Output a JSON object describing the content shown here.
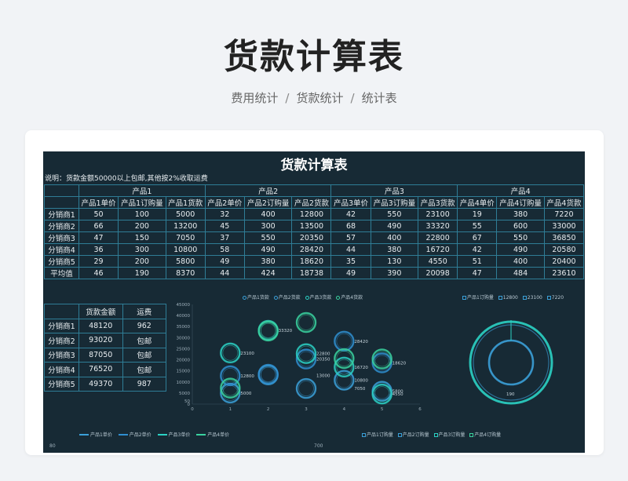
{
  "header": {
    "title": "货款计算表",
    "breadcrumb": [
      "费用统计",
      "货款统计",
      "统计表"
    ],
    "separator": "/"
  },
  "sheet": {
    "title": "货款计算表",
    "note": "说明：货款金额50000以上包邮,其他按2%收取运费",
    "groups": [
      "产品1",
      "产品2",
      "产品3",
      "产品4"
    ],
    "columns": [
      "产品1单价",
      "产品1订购量",
      "产品1货款",
      "产品2单价",
      "产品2订购量",
      "产品2货款",
      "产品3单价",
      "产品3订购量",
      "产品3货款",
      "产品4单价",
      "产品4订购量",
      "产品4货款"
    ],
    "rows": [
      {
        "label": "分销商1",
        "values": [
          "50",
          "100",
          "5000",
          "32",
          "400",
          "12800",
          "42",
          "550",
          "23100",
          "19",
          "380",
          "7220"
        ]
      },
      {
        "label": "分销商2",
        "values": [
          "66",
          "200",
          "13200",
          "45",
          "300",
          "13500",
          "68",
          "490",
          "33320",
          "55",
          "600",
          "33000"
        ]
      },
      {
        "label": "分销商3",
        "values": [
          "47",
          "150",
          "7050",
          "37",
          "550",
          "20350",
          "57",
          "400",
          "22800",
          "67",
          "550",
          "36850"
        ]
      },
      {
        "label": "分销商4",
        "values": [
          "36",
          "300",
          "10800",
          "58",
          "490",
          "28420",
          "44",
          "380",
          "16720",
          "42",
          "490",
          "20580"
        ]
      },
      {
        "label": "分销商5",
        "values": [
          "29",
          "200",
          "5800",
          "49",
          "380",
          "18620",
          "35",
          "130",
          "4550",
          "51",
          "400",
          "20400"
        ]
      },
      {
        "label": "平均值",
        "values": [
          "46",
          "190",
          "8370",
          "44",
          "424",
          "18738",
          "49",
          "390",
          "20098",
          "47",
          "484",
          "23610"
        ]
      }
    ],
    "fee_table": {
      "headers": [
        "",
        "货款金额",
        "运费"
      ],
      "rows": [
        [
          "分销商1",
          "48120",
          "962"
        ],
        [
          "分销商2",
          "93020",
          "包邮"
        ],
        [
          "分销商3",
          "87050",
          "包邮"
        ],
        [
          "分销商4",
          "76520",
          "包邮"
        ],
        [
          "分销商5",
          "49370",
          "987"
        ]
      ]
    }
  },
  "chart_data": [
    {
      "type": "scatter",
      "series": [
        {
          "name": "产品1货款",
          "x": [
            1,
            2,
            3,
            4,
            5
          ],
          "values": [
            5000,
            13200,
            7050,
            10800,
            5800
          ]
        },
        {
          "name": "产品2货款",
          "x": [
            1,
            2,
            3,
            4,
            5
          ],
          "values": [
            12800,
            13500,
            20350,
            28420,
            18620
          ]
        },
        {
          "name": "产品3货款",
          "x": [
            1,
            2,
            3,
            4,
            5
          ],
          "values": [
            23100,
            33320,
            22800,
            16720,
            4550
          ]
        },
        {
          "name": "产品4货款",
          "x": [
            1,
            2,
            3,
            4,
            5
          ],
          "values": [
            7220,
            33000,
            36850,
            20580,
            20400
          ]
        }
      ],
      "yticks": [
        "0",
        "50",
        "5000",
        "10000",
        "15000",
        "20000",
        "25000",
        "30000",
        "35000",
        "40000",
        "45000"
      ],
      "xticks": [
        "0",
        "1",
        "2",
        "3",
        "4",
        "5",
        "6"
      ],
      "point_labels": [
        {
          "x": 1,
          "y": 23100,
          "text": "23100"
        },
        {
          "x": 1,
          "y": 12800,
          "text": "12800"
        },
        {
          "x": 1,
          "y": 5000,
          "text": "5000"
        },
        {
          "x": 2,
          "y": 33320,
          "text": "33320"
        },
        {
          "x": 3,
          "y": 13000,
          "text": "13000"
        },
        {
          "x": 3,
          "y": 22800,
          "text": "22800"
        },
        {
          "x": 3,
          "y": 20350,
          "text": "20350"
        },
        {
          "x": 4,
          "y": 28420,
          "text": "28420"
        },
        {
          "x": 4,
          "y": 16720,
          "text": "16720"
        },
        {
          "x": 4,
          "y": 10800,
          "text": "10800"
        },
        {
          "x": 4,
          "y": 7050,
          "text": "7050"
        },
        {
          "x": 5,
          "y": 18620,
          "text": "18620"
        },
        {
          "x": 5,
          "y": 4550,
          "text": "4550"
        },
        {
          "x": 5,
          "y": 5800,
          "text": "5800"
        }
      ],
      "xlim": [
        0,
        6
      ],
      "ylim": [
        0,
        45000
      ]
    },
    {
      "type": "pie",
      "series": [
        {
          "name": "产品1订购量",
          "values": [
            190
          ]
        },
        {
          "name": "12800",
          "values": [
            12800
          ]
        },
        {
          "name": "23100",
          "values": [
            23100
          ]
        },
        {
          "name": "7220",
          "values": [
            7220
          ]
        }
      ],
      "label": "190"
    }
  ],
  "bottom_left": {
    "legend": [
      "产品1单价",
      "产品2单价",
      "产品3单价",
      "产品4单价"
    ],
    "axis_label": "80"
  },
  "bottom_right": {
    "legend": [
      "产品1订购量",
      "产品2订购量",
      "产品3订购量",
      "产品4订购量"
    ],
    "axis_label": "700"
  },
  "colors": {
    "sheet_bg": "#172a35",
    "grid": "#2f7d96",
    "ring_blue": "#3ba0d8",
    "ring_teal": "#2bd1c4",
    "ring_green": "#3ad29f"
  }
}
